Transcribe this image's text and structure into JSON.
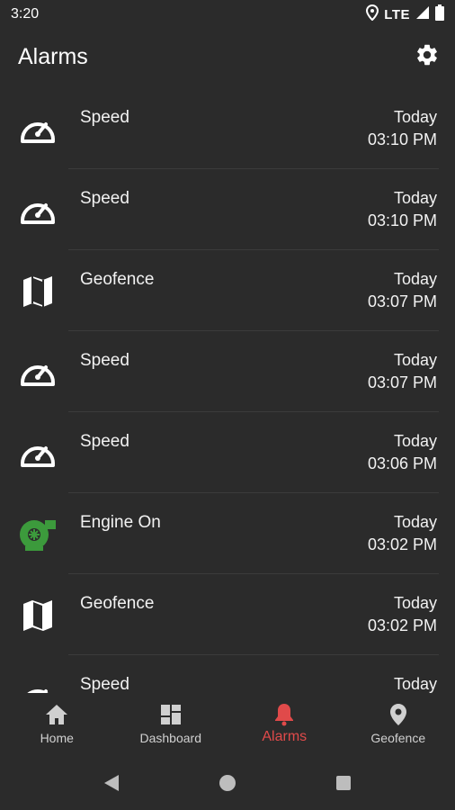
{
  "status_bar": {
    "time": "3:20",
    "network": "LTE"
  },
  "app_bar": {
    "title": "Alarms"
  },
  "alarms": [
    {
      "type": "Speed",
      "icon": "speedometer-icon",
      "day": "Today",
      "time": "03:10 PM"
    },
    {
      "type": "Speed",
      "icon": "speedometer-icon",
      "day": "Today",
      "time": "03:10 PM"
    },
    {
      "type": "Geofence",
      "icon": "map-icon",
      "day": "Today",
      "time": "03:07 PM"
    },
    {
      "type": "Speed",
      "icon": "speedometer-icon",
      "day": "Today",
      "time": "03:07 PM"
    },
    {
      "type": "Speed",
      "icon": "speedometer-icon",
      "day": "Today",
      "time": "03:06 PM"
    },
    {
      "type": "Engine On",
      "icon": "engine-icon",
      "day": "Today",
      "time": "03:02 PM"
    },
    {
      "type": "Geofence",
      "icon": "map-icon",
      "day": "Today",
      "time": "03:02 PM"
    },
    {
      "type": "Speed",
      "icon": "speedometer-icon",
      "day": "Today",
      "time": ""
    }
  ],
  "bottom_nav": {
    "items": [
      {
        "label": "Home",
        "icon": "home-icon"
      },
      {
        "label": "Dashboard",
        "icon": "dashboard-icon"
      },
      {
        "label": "Alarms",
        "icon": "bell-icon",
        "active": true
      },
      {
        "label": "Geofence",
        "icon": "location-pin-icon"
      }
    ]
  },
  "colors": {
    "background": "#2b2b2b",
    "accent": "#e04a4a",
    "engine_green": "#3c9a3c"
  }
}
